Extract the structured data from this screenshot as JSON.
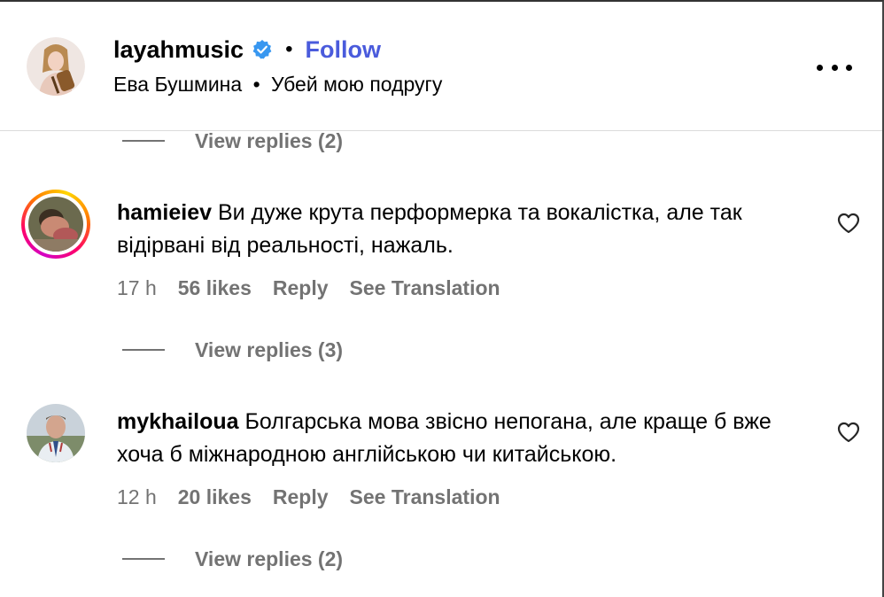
{
  "header": {
    "username": "layahmusic",
    "separator": "•",
    "follow_label": "Follow",
    "subtitle_artist": "Ева Бушмина",
    "subtitle_separator": "•",
    "subtitle_song": "Убей мою подругу",
    "more_icon": "more-horizontal-icon",
    "verified_icon": "verified-badge-icon"
  },
  "view_replies": [
    {
      "label": "View replies (2)"
    },
    {
      "label": "View replies (3)"
    },
    {
      "label": "View replies (2)"
    }
  ],
  "comments": [
    {
      "username": "hamieiev",
      "text": "Ви дуже крута перформерка та вокалістка, але так відірвані від реальності, нажаль.",
      "time": "17 h",
      "likes": "56 likes",
      "reply_label": "Reply",
      "translate_label": "See Translation",
      "has_story_ring": true
    },
    {
      "username": "mykhailoua",
      "text": "Болгарська мова звісно непогана, але краще б вже хоча б міжнародною англійською чи китайською.",
      "time": "12 h",
      "likes": "20 likes",
      "reply_label": "Reply",
      "translate_label": "See Translation",
      "has_story_ring": false
    }
  ],
  "colors": {
    "follow": "#4a5bdc",
    "muted_text": "#737373",
    "verified": "#3897f0",
    "divider": "#dbdbdb"
  }
}
